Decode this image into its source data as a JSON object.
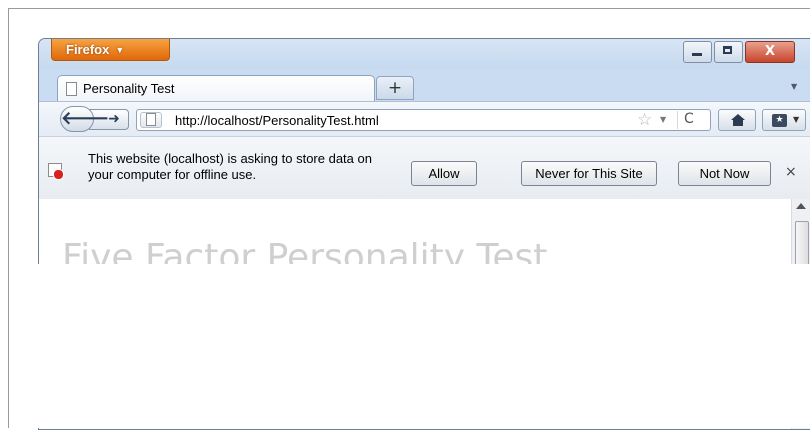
{
  "browser": {
    "menu_button": "Firefox",
    "menu_caret": "▼",
    "window_controls": {
      "minimize": "minimize-icon",
      "maximize": "maximize-icon",
      "close": "X"
    }
  },
  "tabs": [
    {
      "label": "Personality Test",
      "active": true
    }
  ],
  "new_tab_label": "+",
  "tab_list_glyph": "▼",
  "navigation": {
    "back_glyph": "🡐",
    "forward_glyph": "➜",
    "url": "http://localhost/PersonalityTest.html",
    "bookmark_star": "☆",
    "history_drop": "▼",
    "reload_glyph": "C"
  },
  "notification": {
    "message": "This website (localhost) is asking to store data on your computer for offline use.",
    "buttons": {
      "allow": "Allow",
      "never": "Never for This Site",
      "not_now": "Not Now"
    },
    "close": "×"
  },
  "page": {
    "heading": "Five Factor Personality Test"
  },
  "colors": {
    "firefox_orange": "#e0680a",
    "chrome_blue": "#c9dcf1",
    "close_red": "#c7452c"
  }
}
